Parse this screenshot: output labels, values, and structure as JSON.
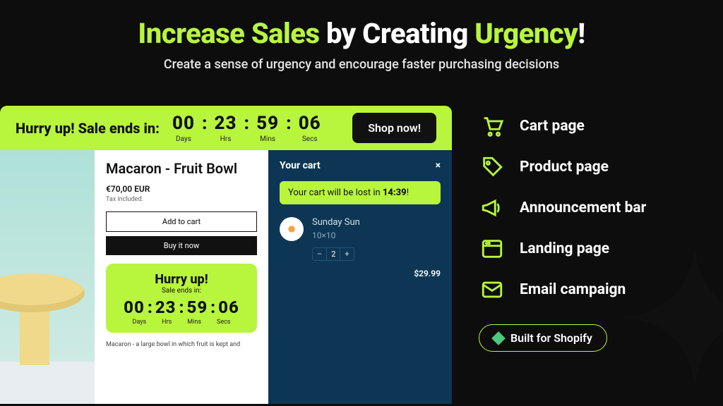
{
  "hero": {
    "title_parts": [
      "Increase Sales",
      " by Creating ",
      "Urgency",
      "!"
    ],
    "subtitle": "Create a sense of urgency and encourage faster purchasing decisions"
  },
  "announcement": {
    "label": "Hurry up! Sale ends in:",
    "timer": {
      "days": "00",
      "hours": "23",
      "minutes": "59",
      "seconds": "06",
      "labels": {
        "days": "Days",
        "hours": "Hrs",
        "minutes": "Mins",
        "seconds": "Secs"
      }
    },
    "cta": "Shop now!"
  },
  "product": {
    "title": "Macaron - Fruit Bowl",
    "price": "€70,00 EUR",
    "tax_note": "Tax included.",
    "add_to_cart": "Add to cart",
    "buy_now": "Buy it now",
    "timer": {
      "heading": "Hurry up!",
      "sub": "Sale ends in:",
      "days": "00",
      "hours": "23",
      "minutes": "59",
      "seconds": "06",
      "labels": {
        "days": "Days",
        "hours": "Hrs",
        "minutes": "Mins",
        "seconds": "Secs"
      }
    },
    "description": "Macaron - a large bowl in which fruit is kept and"
  },
  "cart": {
    "title": "Your cart",
    "close_glyph": "×",
    "alert_prefix": "Your cart will be lost in ",
    "alert_time": "14:39",
    "alert_suffix": "!",
    "item": {
      "name": "Sunday Sun",
      "variant": "10×10",
      "qty_minus": "–",
      "qty_value": "2",
      "qty_plus": "+",
      "price": "$29.99"
    }
  },
  "features": [
    {
      "icon": "cart-icon",
      "label": "Cart page"
    },
    {
      "icon": "tag-icon",
      "label": "Product page"
    },
    {
      "icon": "megaphone-icon",
      "label": "Announcement bar"
    },
    {
      "icon": "window-icon",
      "label": "Landing page"
    },
    {
      "icon": "mail-icon",
      "label": "Email campaign"
    }
  ],
  "badge": {
    "label": "Built for Shopify"
  },
  "colors": {
    "accent": "#b8f53d",
    "bg": "#0d0d0d",
    "cart_bg": "#0d3654"
  }
}
